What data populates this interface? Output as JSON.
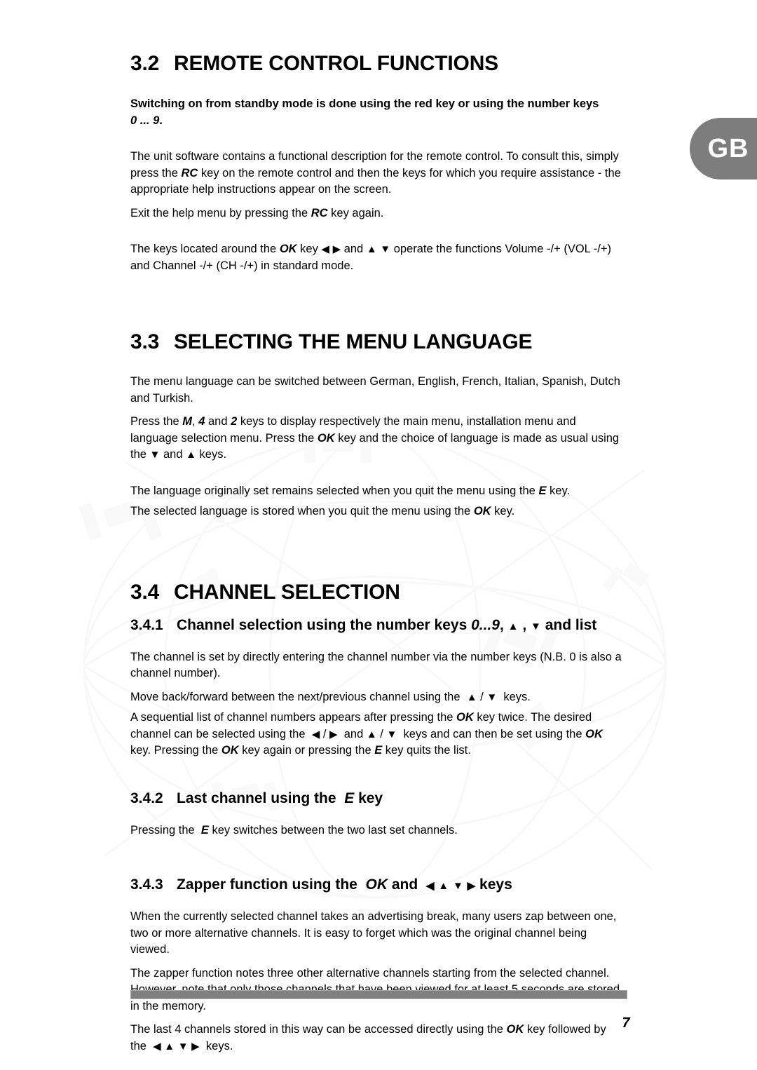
{
  "language_tab": {
    "label": "GB"
  },
  "sections": {
    "s32": {
      "number": "3.2",
      "title": "REMOTE CONTROL FUNCTIONS",
      "lead_line1": "Switching on from standby mode is done using the red key or using the number keys",
      "lead_keys": "0 ... 9",
      "lead_end": ".",
      "p1_a": "The unit software contains a functional description for the remote control. To consult this, simply press the ",
      "p1_key1": "RC",
      "p1_b": " key on the remote control and then the keys for which you require assistance - the appropriate help instructions appear on the screen.",
      "p2_a": "Exit the help menu by pressing the ",
      "p2_key1": "RC",
      "p2_b": " key again.",
      "p3_a": "The keys located around the ",
      "p3_key1": "OK",
      "p3_b": " key ",
      "p3_arrow_left": "◀",
      "p3_arrow_right": "▶",
      "p3_c": " and ",
      "p3_arrow_up": "▲",
      "p3_arrow_down": "▼",
      "p3_d": " operate the functions Volume -/+ (VOL -/+) and Channel -/+ (CH -/+) in standard mode."
    },
    "s33": {
      "number": "3.3",
      "title": "SELECTING THE MENU LANGUAGE",
      "p1": "The menu language can be switched between German, English, French, Italian, Spanish, Dutch and Turkish.",
      "p2_a": "Press the ",
      "p2_key_m": "M",
      "p2_b": ", ",
      "p2_key_4": "4",
      "p2_c": " and ",
      "p2_key_2": "2",
      "p2_d": " keys to display respectively the main menu, installation menu and language selection menu. Press the ",
      "p2_key_ok": "OK",
      "p2_e": " key and the choice of language is made as usual using the ",
      "p2_arrow_down": "▼",
      "p2_f": " and ",
      "p2_arrow_up": "▲",
      "p2_g": " keys.",
      "p3_a": "The language originally set remains selected when you quit the menu using the ",
      "p3_key_e": "E",
      "p3_b": " key.",
      "p4_a": "The selected language is stored when you quit the menu using the ",
      "p4_key_ok": "OK",
      "p4_b": " key."
    },
    "s34": {
      "number": "3.4",
      "title": "CHANNEL SELECTION",
      "sub1": {
        "number": "3.4.1",
        "title_a": "Channel selection using the number keys ",
        "title_keys": "0...9",
        "title_b": ", ",
        "title_arrow_up": "▲",
        "title_c": " , ",
        "title_arrow_down": "▼",
        "title_d": " and list",
        "p1": "The channel is set by directly entering the channel number via the number keys (N.B. 0 is also a channel number).",
        "p2_a": "Move back/forward between the next/previous channel using the ",
        "p2_arrow_up": "▲",
        "p2_b": " / ",
        "p2_arrow_down": "▼",
        "p2_c": " keys.",
        "p3_a": "A sequential list of channel numbers appears after pressing the ",
        "p3_key_ok1": "OK",
        "p3_b": " key twice. The desired channel can be selected using the ",
        "p3_arrow_left": "◀",
        "p3_c": " / ",
        "p3_arrow_right": "▶",
        "p3_d": " and ",
        "p3_arrow_up": "▲",
        "p3_e": " / ",
        "p3_arrow_down": "▼",
        "p3_f": " keys and can then be set using the ",
        "p3_key_ok2": "OK",
        "p3_g": " key. Pressing the ",
        "p3_key_ok3": "OK",
        "p3_h": " key again or pressing the ",
        "p3_key_e": "E",
        "p3_i": " key quits the list."
      },
      "sub2": {
        "number": "3.4.2",
        "title_a": "Last channel using the ",
        "title_key_e": "E",
        "title_b": " key",
        "p1_a": "Pressing the ",
        "p1_key_e": "E",
        "p1_b": " key switches between the two last set channels."
      },
      "sub3": {
        "number": "3.4.3",
        "title_a": "Zapper function using the ",
        "title_key_ok": "OK",
        "title_b": " and ",
        "title_arrow_left": "◀",
        "title_arrow_up": "▲",
        "title_arrow_down": "▼",
        "title_arrow_right": "▶",
        "title_c": " keys",
        "p1": "When the currently selected channel takes an advertising break, many users zap between one, two or more alternative channels. It is easy to forget which was the original channel being viewed.",
        "p2": "The zapper function notes three other alternative channels starting from the selected channel. However, note that only those channels that have been viewed for at least 5 seconds are stored in the memory.",
        "p3_a": "The last 4 channels stored in this way can be accessed directly using the ",
        "p3_key_ok": "OK",
        "p3_b": " key followed by the ",
        "p3_arrow_left": "◀",
        "p3_arrow_up": "▲",
        "p3_arrow_down": "▼",
        "p3_arrow_right": "▶",
        "p3_c": " keys."
      }
    }
  },
  "footer": {
    "page_number": "7"
  },
  "colors": {
    "tab_gray": "#7d7d7d",
    "rule_gray": "#808080",
    "text": "#000000"
  }
}
